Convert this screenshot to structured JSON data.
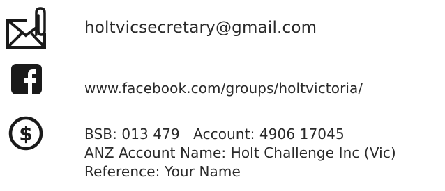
{
  "contact": {
    "email": {
      "icon": "envelope-paperclip-icon",
      "text": "holtvicsecretary@gmail.com"
    },
    "facebook": {
      "icon": "facebook-icon",
      "text": "www.facebook.com/groups/holtvictoria/"
    },
    "bank": {
      "icon": "dollar-coin-icon",
      "line1": "BSB: 013 479   Account: 4906 17045",
      "line2": "ANZ Account Name: Holt Challenge Inc (Vic)",
      "line3": "Reference: Your Name"
    }
  },
  "colors": {
    "text": "#2a2a2a",
    "icon": "#1a1a1a"
  }
}
